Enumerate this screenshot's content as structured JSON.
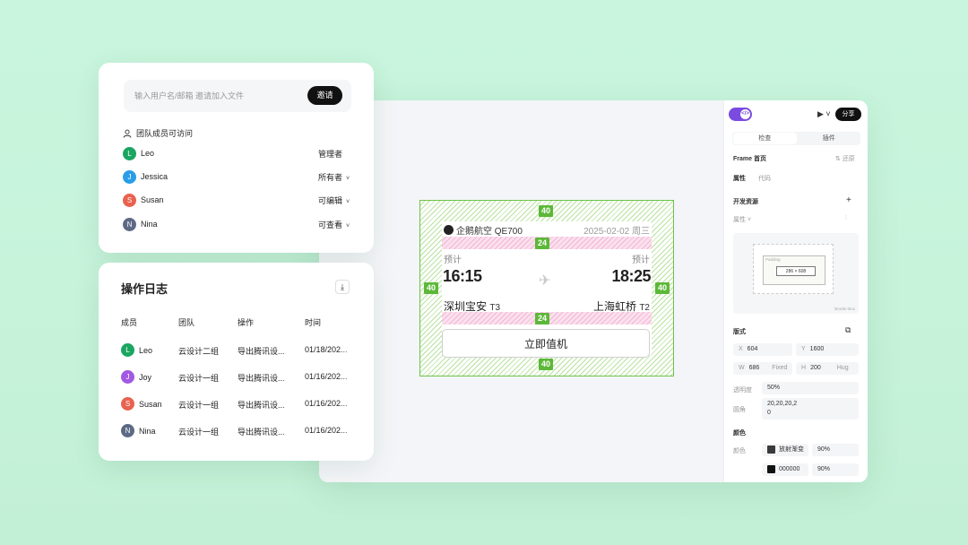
{
  "members_card": {
    "invite_placeholder": "输入用户名/邮箱 邀请加入文件",
    "invite_button": "邀请",
    "team_access_label": "团队成员可访问",
    "members": [
      {
        "initial": "L",
        "name": "Leo",
        "role": "管理者",
        "color": "#1aa561",
        "has_dropdown": false
      },
      {
        "initial": "J",
        "name": "Jessica",
        "role": "所有者",
        "color": "#2a9de8",
        "has_dropdown": true
      },
      {
        "initial": "S",
        "name": "Susan",
        "role": "可编辑",
        "color": "#e8624f",
        "has_dropdown": true
      },
      {
        "initial": "N",
        "name": "Nina",
        "role": "可查看",
        "color": "#5d6a85",
        "has_dropdown": true
      }
    ]
  },
  "log_card": {
    "title": "操作日志",
    "download_icon": "download-icon",
    "headers": [
      "成员",
      "团队",
      "操作",
      "时间"
    ],
    "rows": [
      {
        "initial": "L",
        "member": "Leo",
        "team": "云设计二组",
        "action": "导出腾讯设...",
        "time": "01/18/202...",
        "color": "#1aa561"
      },
      {
        "initial": "J",
        "member": "Joy",
        "team": "云设计一组",
        "action": "导出腾讯设...",
        "time": "01/16/202...",
        "color": "#a259e0"
      },
      {
        "initial": "S",
        "member": "Susan",
        "team": "云设计一组",
        "action": "导出腾讯设...",
        "time": "01/16/202...",
        "color": "#e8624f"
      },
      {
        "initial": "N",
        "member": "Nina",
        "team": "云设计一组",
        "action": "导出腾讯设...",
        "time": "01/16/202...",
        "color": "#5d6a85"
      }
    ]
  },
  "flight_card": {
    "airline": "企鹅航空 QE700",
    "date": "2025-02-02 周三",
    "dep_label": "预计",
    "arr_label": "预计",
    "dep_time": "16:15",
    "arr_time": "18:25",
    "dep_city": "深圳宝安",
    "dep_terminal": "T3",
    "arr_city": "上海虹桥",
    "arr_terminal": "T2",
    "checkin_button": "立即值机",
    "padding_tags": {
      "top": "40",
      "bottom": "40",
      "left": "40",
      "right": "40",
      "gap1": "24",
      "gap2": "24"
    }
  },
  "panel": {
    "share": "分享",
    "tabs": [
      "检查",
      "插件"
    ],
    "frame_label": "Frame 首页",
    "restore": "还原",
    "subtabs": [
      "属性",
      "代码"
    ],
    "dev_resources": "开发资源",
    "property": "属性",
    "minimap": {
      "margin": "Margin",
      "padding": "Padding",
      "size": "286 × 608",
      "caption": "Border-Box"
    },
    "layout_label": "版式",
    "x_label": "X",
    "x_value": "604",
    "y_label": "Y",
    "y_value": "1600",
    "w_label": "W",
    "w_value": "686",
    "w_mode": "Fixed",
    "h_label": "H",
    "h_value": "200",
    "h_mode": "Hug",
    "opacity_label": "透明度",
    "opacity_value": "50%",
    "radius_label": "圆角",
    "radius_value_line1": "20,20,20,2",
    "radius_value_line2": "0",
    "color_section": "颜色",
    "color_label": "颜色",
    "colors": [
      {
        "name": "放射渐变",
        "opacity": "90%",
        "swatch": "#3a3a3a"
      },
      {
        "name": "000000",
        "opacity": "90%",
        "swatch": "#111111"
      }
    ]
  }
}
